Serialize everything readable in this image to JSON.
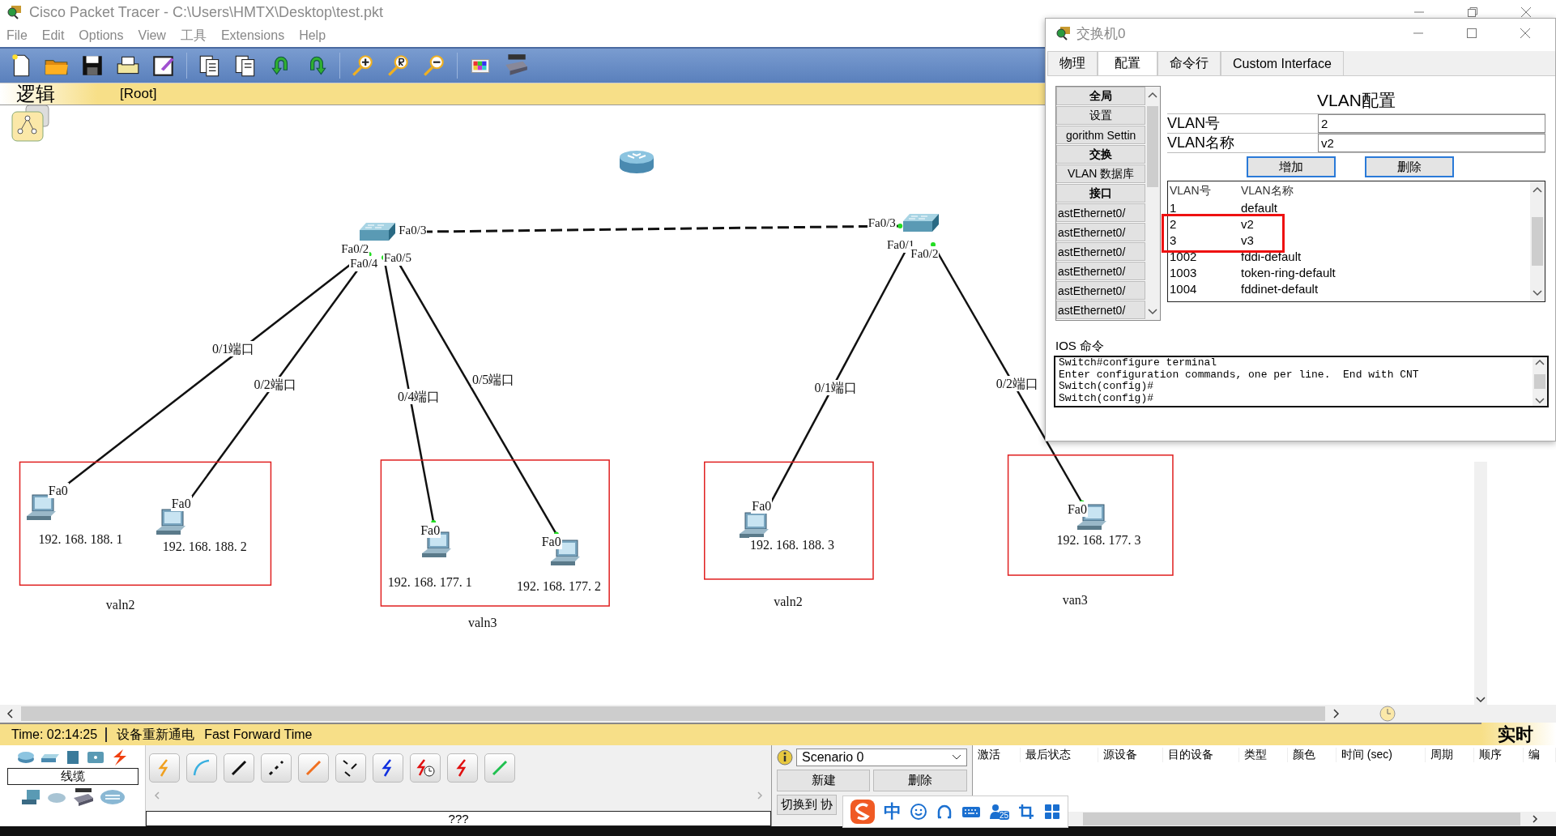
{
  "window": {
    "title": "Cisco Packet Tracer - C:\\Users\\HMTX\\Desktop\\test.pkt"
  },
  "menu": [
    "File",
    "Edit",
    "Options",
    "View",
    "工具",
    "Extensions",
    "Help"
  ],
  "workspace_bar": {
    "mode": "逻辑",
    "path": "[Root]"
  },
  "network": {
    "port_labels": [
      "Fa0/3",
      "Fa0/2",
      "Fa0/4",
      "Fa0/5",
      "Fa0/3",
      "Fa0/1",
      "Fa0/2"
    ],
    "link_labels": [
      "0/1端口",
      "0/2端口",
      "0/4端口",
      "0/5端口",
      "0/1端口",
      "0/2端口"
    ],
    "hosts": [
      {
        "port": "Fa0",
        "ip": "192. 168. 188. 1"
      },
      {
        "port": "Fa0",
        "ip": "192. 168. 188. 2"
      },
      {
        "port": "Fa0",
        "ip": "192. 168. 177. 1"
      },
      {
        "port": "Fa0",
        "ip": "192. 168. 177. 2"
      },
      {
        "port": "Fa0",
        "ip": "192. 168. 188. 3"
      },
      {
        "port": "Fa0",
        "ip": "192. 168. 177. 3"
      }
    ],
    "groups": [
      "valn2",
      "valn3",
      "valn2",
      "van3"
    ]
  },
  "dialog": {
    "title": "交换机0",
    "tabs": [
      {
        "label": "物理",
        "selected": false
      },
      {
        "label": "配置",
        "selected": true
      },
      {
        "label": "命令行",
        "selected": false
      },
      {
        "label": "Custom Interface",
        "selected": false
      }
    ],
    "nav": [
      {
        "text": "全局",
        "kind": "header"
      },
      {
        "text": "设置",
        "kind": "item"
      },
      {
        "text": "gorithm Settin",
        "kind": "item"
      },
      {
        "text": "交换",
        "kind": "header"
      },
      {
        "text": "VLAN 数据库",
        "kind": "item"
      },
      {
        "text": "接口",
        "kind": "header"
      },
      {
        "text": "astEthernet0/",
        "kind": "port"
      },
      {
        "text": "astEthernet0/",
        "kind": "port"
      },
      {
        "text": "astEthernet0/",
        "kind": "port"
      },
      {
        "text": "astEthernet0/",
        "kind": "port"
      },
      {
        "text": "astEthernet0/",
        "kind": "port"
      },
      {
        "text": "astEthernet0/",
        "kind": "port"
      }
    ],
    "heading": "VLAN配置",
    "fields": [
      {
        "label": "VLAN号",
        "value": "2"
      },
      {
        "label": "VLAN名称",
        "value": "v2"
      }
    ],
    "buttons": [
      "增加",
      "删除"
    ],
    "vlan_table": {
      "columns": [
        "VLAN号",
        "VLAN名称"
      ],
      "rows": [
        {
          "cells": [
            "1",
            "default"
          ],
          "marked": false
        },
        {
          "cells": [
            "2",
            "v2"
          ],
          "marked": true
        },
        {
          "cells": [
            "3",
            "v3"
          ],
          "marked": true
        },
        {
          "cells": [
            "1002",
            "fddi-default"
          ],
          "marked": false
        },
        {
          "cells": [
            "1003",
            "token-ring-default"
          ],
          "marked": false
        },
        {
          "cells": [
            "1004",
            "fddinet-default"
          ],
          "marked": false
        }
      ]
    },
    "ios": {
      "label": "IOS 命令",
      "lines": [
        "Switch#configure terminal",
        "Enter configuration commands, one per line.  End with CNT",
        "Switch(config)#",
        "Switch(config)#"
      ]
    }
  },
  "status_bar": {
    "time": "Time: 02:14:25",
    "actions": [
      "设备重新通电",
      "Fast Forward Time"
    ],
    "mode": "实时"
  },
  "device_panel": {
    "category": "线缆",
    "cable_info": "???"
  },
  "scenario": {
    "value": "Scenario 0",
    "buttons": [
      "新建",
      "删除"
    ],
    "switch_button": "切换到 协"
  },
  "event_list": {
    "columns": [
      "激活",
      "最后状态",
      "源设备",
      "目的设备",
      "类型",
      "颜色",
      "时间 (sec)",
      "周期",
      "顺序",
      "编"
    ]
  },
  "ime_toolbar": {
    "mode": "中",
    "badge": "25"
  }
}
